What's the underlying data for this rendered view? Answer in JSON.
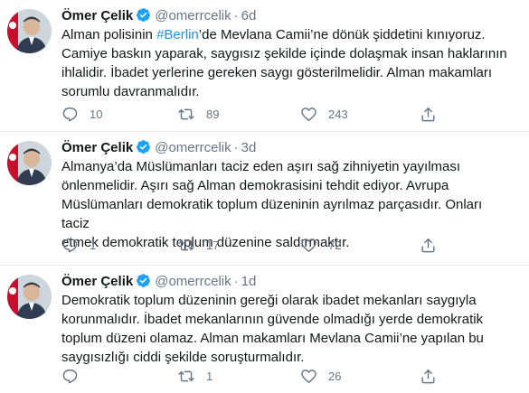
{
  "tweets": [
    {
      "name": "Ömer Çelik",
      "handle": "@omerrcelik",
      "separator": "·",
      "time": "6d",
      "text_before": "Alman polisinin ",
      "hashtag": "#Berlin",
      "text_after": "’de Mevlana Camii’ne dönük şiddetini kınıyoruz.\nCamiye baskın yaparak, saygısız şekilde içinde dolaşmak insan haklarının\nihlalidir. İbadet yerlerine gereken saygı gösterilmelidir. Alman makamları\nsorumlu davranmalıdır.",
      "replies": "10",
      "retweets": "89",
      "likes": "243"
    },
    {
      "name": "Ömer Çelik",
      "handle": "@omerrcelik",
      "separator": "·",
      "time": "3d",
      "text": "Almanya’da Müslümanları taciz eden aşırı sağ zihniyetin yayılması\nönlenmelidir. Aşırı sağ Alman demokrasisini tehdit ediyor. Avrupa\nMüslümanları demokratik toplum düzeninin ayrılmaz parçasıdır. Onları taciz\netmek demokratik toplum düzenine saldırmaktır.",
      "replies": "1",
      "retweets": "17",
      "likes": "72"
    },
    {
      "name": "Ömer Çelik",
      "handle": "@omerrcelik",
      "separator": "·",
      "time": "1d",
      "text": "Demokratik toplum düzeninin gereği olarak ibadet mekanları saygıyla\nkorunmalıdır. İbadet mekanlarının güvende olmadığı yerde demokratik\ntoplum düzeni olamaz. Alman makamları Mevlana Camii’ne yapılan bu\nsaygısızlığı ciddi şekilde soruşturmalıdır.",
      "replies": "",
      "retweets": "1",
      "likes": "26"
    }
  ],
  "icons": {
    "verified": "verified-badge-icon",
    "reply": "reply-icon",
    "retweet": "retweet-icon",
    "like": "heart-icon",
    "share": "share-icon"
  },
  "colors": {
    "text": "#14171a",
    "secondary": "#657786",
    "link": "#1b95e0",
    "verified": "#1da1f2",
    "divider": "#e6ecf0"
  }
}
